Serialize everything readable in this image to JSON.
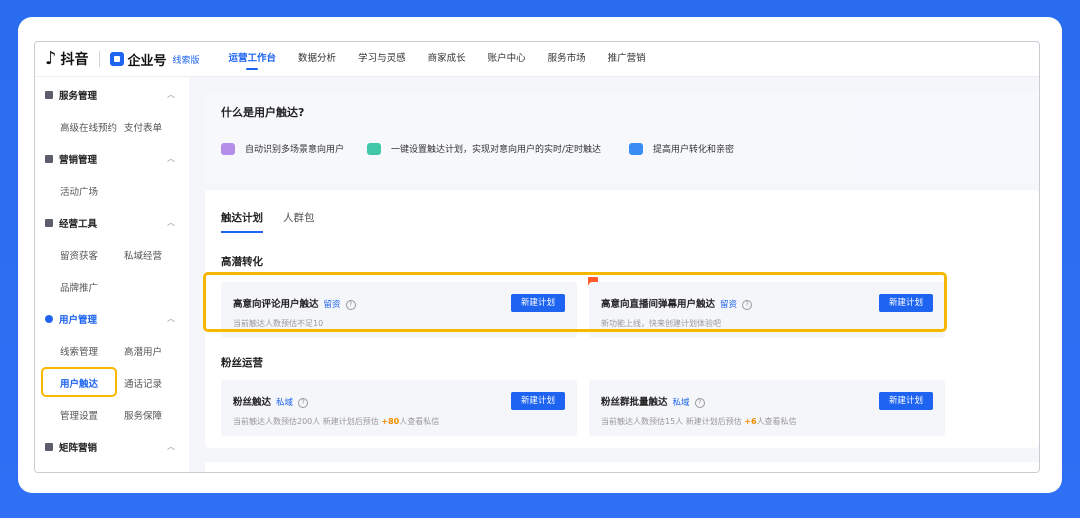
{
  "header": {
    "douyin_logo": "抖音",
    "enterprise_logo": "企业号",
    "edition": "线索版",
    "nav": [
      {
        "label": "运营工作台",
        "active": true
      },
      {
        "label": "数据分析",
        "active": false
      },
      {
        "label": "学习与灵感",
        "active": false
      },
      {
        "label": "商家成长",
        "active": false
      },
      {
        "label": "账户中心",
        "active": false
      },
      {
        "label": "服务市场",
        "active": false
      },
      {
        "label": "推广营销",
        "active": false
      }
    ]
  },
  "sidebar": {
    "groups": [
      {
        "label": "服务管理",
        "items": [
          "高级在线预约",
          "支付表单"
        ]
      },
      {
        "label": "营销管理",
        "items": [
          "活动广场"
        ]
      },
      {
        "label": "经营工具",
        "items": [
          "留资获客",
          "私域经营",
          "品牌推广"
        ]
      },
      {
        "label": "用户管理",
        "items": [
          "线索管理",
          "高潜用户",
          "用户触达",
          "通话记录",
          "管理设置",
          "服务保障"
        ]
      },
      {
        "label": "矩阵营销",
        "items": []
      }
    ],
    "active_item": "用户触达"
  },
  "intro": {
    "title": "什么是用户触达?",
    "features": [
      {
        "icon": "user-group-icon",
        "text": "自动识别多场景意向用户",
        "color": "#b48ee8"
      },
      {
        "icon": "paper-plane-icon",
        "text": "一键设置触达计划，实现对意向用户的实时/定时触达",
        "color": "#3fc7a8"
      },
      {
        "icon": "chart-card-icon",
        "text": "提高用户转化和亲密",
        "color": "#3a8cf5"
      }
    ]
  },
  "tabs": [
    {
      "label": "触达计划",
      "active": true
    },
    {
      "label": "人群包",
      "active": false
    }
  ],
  "sections": [
    {
      "title": "高潜转化",
      "cards": [
        {
          "title": "高意向评论用户触达",
          "tag": "留资",
          "subtitle": "当前触达人数预估不足10",
          "button": "新建计划"
        },
        {
          "title": "高意向直播间弹幕用户触达",
          "tag": "留资",
          "subtitle": "新功能上线，快来创建计划体验吧",
          "button": "新建计划"
        }
      ]
    },
    {
      "title": "粉丝运营",
      "cards": [
        {
          "title": "粉丝触达",
          "tag": "私域",
          "subtitle_prefix": "当前触达人数预估200人  新建计划后预估 ",
          "subtitle_num": "+80",
          "subtitle_suffix": "人查看私信",
          "button": "新建计划"
        },
        {
          "title": "粉丝群批量触达",
          "tag": "私域",
          "subtitle_prefix": "当前触达人数预估15人  新建计划后预估 ",
          "subtitle_num": "+6",
          "subtitle_suffix": "人查看私信",
          "button": "新建计划"
        }
      ]
    }
  ],
  "colors": {
    "accent": "#1e64f0",
    "highlight": "#f5b700",
    "background": "#2f6ff5"
  }
}
